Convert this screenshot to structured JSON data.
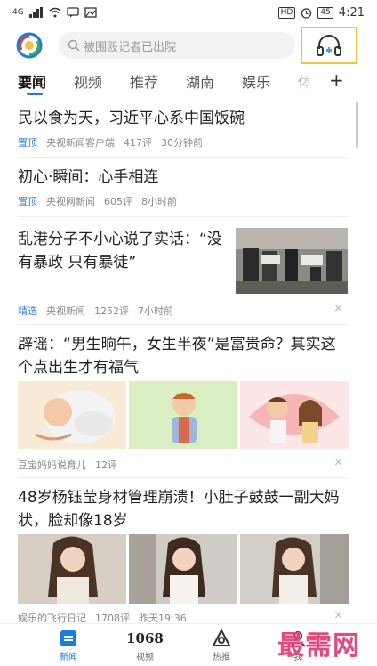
{
  "status": {
    "left": "4G",
    "battery": "45",
    "hd": "HD",
    "time": "4:21"
  },
  "search": {
    "placeholder": "被围殴记者已出院"
  },
  "tabs": [
    {
      "label": "要闻",
      "active": true
    },
    {
      "label": "视频"
    },
    {
      "label": "推荐"
    },
    {
      "label": "湖南"
    },
    {
      "label": "娱乐"
    },
    {
      "label": "体"
    }
  ],
  "tab_add": "+",
  "articles": [
    {
      "title": "民以食为天，习近平心系中国饭碗",
      "tag": "置顶",
      "source": "央视新闻客户端",
      "comments": "417评",
      "time": "30分钟前"
    },
    {
      "title": "初心·瞬间：心手相连",
      "tag": "置顶",
      "source": "央视网新闻",
      "comments": "605评",
      "time": "8小时前"
    },
    {
      "title": "乱港分子不小心说了实话：“没有暴政 只有暴徒”",
      "tag": "精选",
      "source": "央视新闻",
      "comments": "1252评",
      "time": "7小时前"
    },
    {
      "title": "辟谣：“男生晌午，女生半夜”是富贵命？其实这个点出生才有福气",
      "tag": "",
      "source": "豆宝妈妈说育儿",
      "comments": "12评",
      "time": ""
    },
    {
      "title": "48岁杨钰莹身材管理崩溃！小肚子鼓鼓一副大妈状，脸却像18岁",
      "tag": "",
      "source": "娱乐的飞行日记",
      "comments": "1708评",
      "time": "昨天19:36"
    }
  ],
  "dismiss": "×",
  "bottom_nav": [
    {
      "label": "新闻",
      "icon": "news-icon",
      "active": true
    },
    {
      "label": "视频",
      "icon": "1068",
      "active": false
    },
    {
      "label": "热推",
      "icon": "hot-icon",
      "active": false
    },
    {
      "label": "我",
      "icon": "me-icon",
      "active": false
    }
  ],
  "watermark": "最需网",
  "colors": {
    "accent": "#1a7de0",
    "tag_blue": "#3a7fd5",
    "highlight": "#f3c243",
    "watermark": "#e04a7f"
  }
}
